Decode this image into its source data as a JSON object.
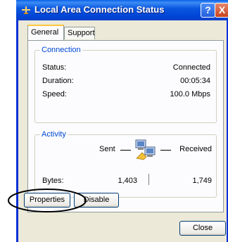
{
  "window": {
    "title": "Local Area Connection Status"
  },
  "titlebar_buttons": {
    "help": "?",
    "close": "X"
  },
  "tabs": [
    {
      "label": "General"
    },
    {
      "label": "Support"
    }
  ],
  "connection": {
    "title": "Connection",
    "rows": [
      {
        "label": "Status:",
        "value": "Connected"
      },
      {
        "label": "Duration:",
        "value": "00:05:34"
      },
      {
        "label": "Speed:",
        "value": "100.0 Mbps"
      }
    ]
  },
  "activity": {
    "title": "Activity",
    "sent_label": "Sent",
    "received_label": "Received",
    "bytes_label": "Bytes:",
    "bytes_sent": "1,403",
    "bytes_received": "1,749"
  },
  "buttons": {
    "properties": "Properties",
    "disable": "Disable",
    "close": "Close"
  },
  "colors": {
    "titlebar": "#0054E3",
    "group_title": "#0046D5",
    "dialog_bg": "#ECE9D8",
    "highlight_ellipse": "#000000"
  }
}
